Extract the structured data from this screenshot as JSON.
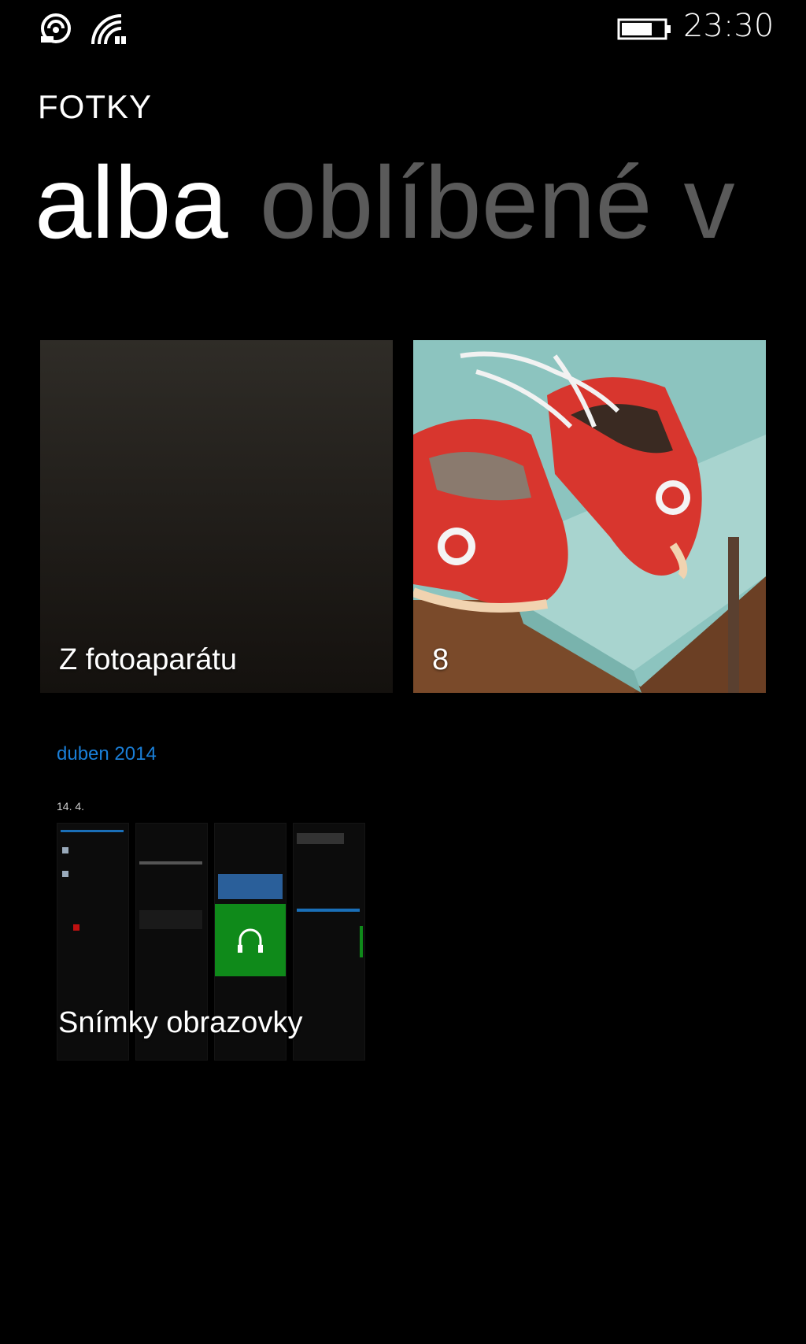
{
  "status_bar": {
    "time": "23:30",
    "icons": [
      "nfc-icon",
      "signal-icon",
      "battery-icon"
    ]
  },
  "app": {
    "title": "FOTKY"
  },
  "pivot": {
    "items": [
      {
        "label": "alba",
        "active": true
      },
      {
        "label": "oblíbené",
        "active": false
      },
      {
        "label": "v",
        "active": false
      }
    ]
  },
  "albums": [
    {
      "label": "Z fotoaparátu"
    },
    {
      "label": "8"
    }
  ],
  "sections": [
    {
      "header": "duben 2014",
      "date": "14. 4.",
      "album": {
        "label": "Snímky obrazovky"
      }
    }
  ],
  "colors": {
    "background": "#000000",
    "accent": "#1a7fd8",
    "inactive_pivot": "#5a5a5a",
    "tile_green": "#0f8a1a"
  }
}
